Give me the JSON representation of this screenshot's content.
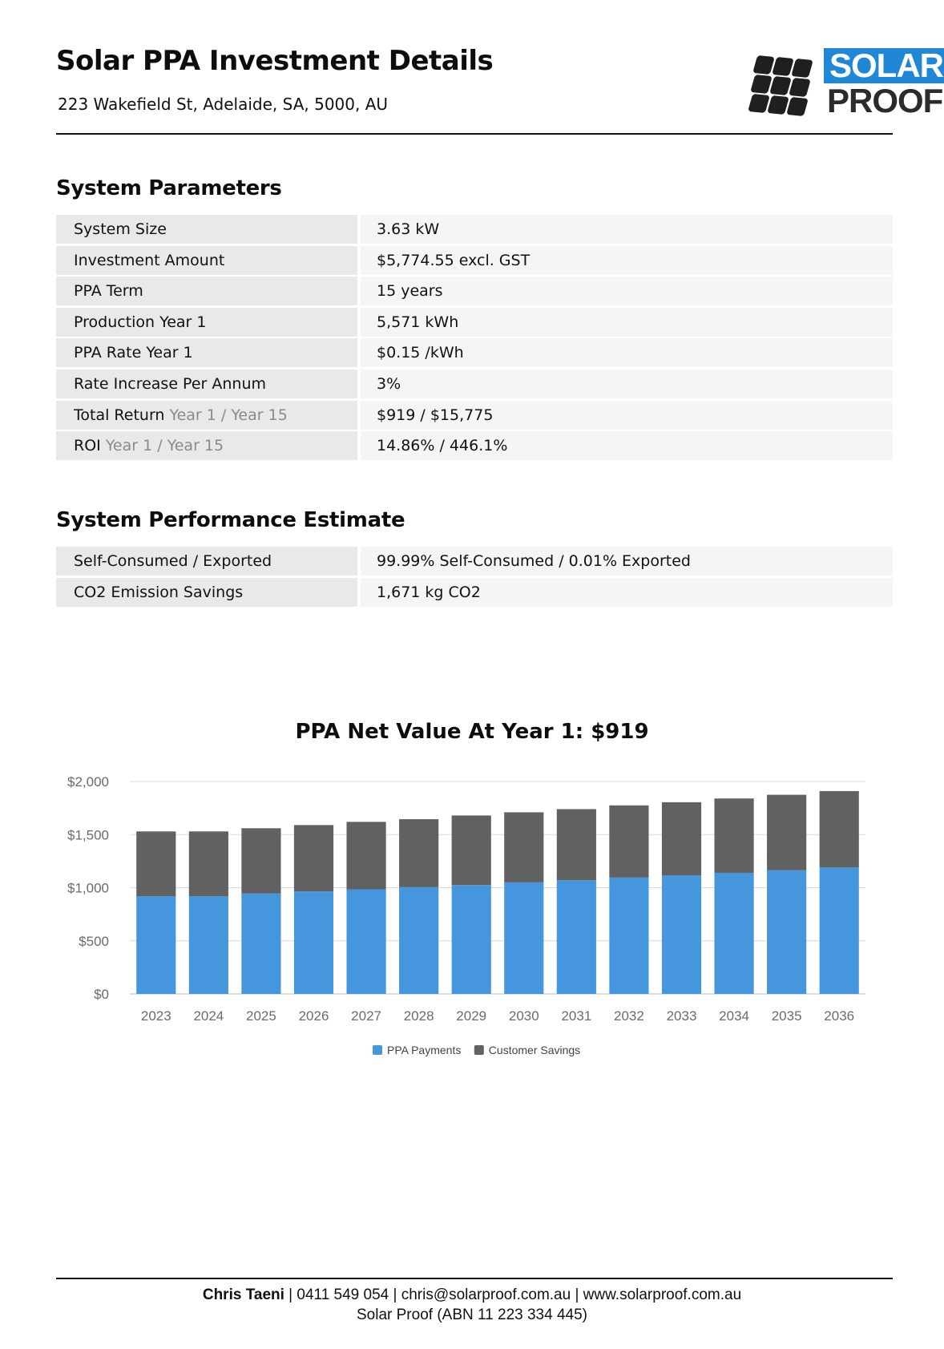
{
  "header": {
    "title": "Solar PPA Investment Details",
    "address": "223 Wakefield St, Adelaide, SA, 5000, AU",
    "logo_top": "SOLAR",
    "logo_bottom": "PROOF",
    "logo_colors": {
      "accent": "#1f87d6",
      "dark": "#2b2b2b"
    }
  },
  "system_parameters": {
    "title": "System Parameters",
    "rows": [
      {
        "label": "System Size",
        "value": "3.63 kW"
      },
      {
        "label": "Investment Amount",
        "value": "$5,774.55 excl. GST"
      },
      {
        "label": "PPA Term",
        "value": "15 years"
      },
      {
        "label": "Production Year 1",
        "value": "5,571 kWh"
      },
      {
        "label": "PPA Rate Year 1",
        "value": "$0.15 /kWh"
      },
      {
        "label": "Rate Increase Per Annum",
        "value": "3%"
      },
      {
        "label": "Total Return",
        "label_suffix": "Year 1 / Year 15",
        "value": "$919 / $15,775"
      },
      {
        "label": "ROI",
        "label_suffix": "Year 1 / Year 15",
        "value": "14.86% / 446.1%"
      }
    ]
  },
  "performance": {
    "title": "System Performance Estimate",
    "rows": [
      {
        "label": "Self-Consumed / Exported",
        "value": "99.99% Self-Consumed / 0.01% Exported"
      },
      {
        "label": "CO2 Emission Savings",
        "value": "1,671 kg CO2"
      }
    ]
  },
  "chart_data": {
    "type": "bar",
    "stacked": true,
    "title": "PPA Net Value At Year 1: $919",
    "categories": [
      "2023",
      "2024",
      "2025",
      "2026",
      "2027",
      "2028",
      "2029",
      "2030",
      "2031",
      "2032",
      "2033",
      "2034",
      "2035",
      "2036"
    ],
    "series": [
      {
        "name": "PPA Payments",
        "color": "#4596dd",
        "values": [
          920,
          920,
          945,
          965,
          985,
          1005,
          1025,
          1050,
          1070,
          1095,
          1115,
          1140,
          1165,
          1190
        ]
      },
      {
        "name": "Customer Savings",
        "color": "#616161",
        "values": [
          610,
          610,
          615,
          625,
          635,
          640,
          655,
          660,
          670,
          680,
          690,
          700,
          710,
          720
        ]
      }
    ],
    "ylim": [
      0,
      2000
    ],
    "yticks": [
      0,
      500,
      1000,
      1500,
      2000
    ],
    "ytick_labels": [
      "$0",
      "$500",
      "$1,000",
      "$1,500",
      "$2,000"
    ],
    "grid": true,
    "legend_position": "bottom"
  },
  "footer": {
    "name": "Chris Taeni",
    "contact": " | 0411 549 054 | chris@solarproof.com.au | www.solarproof.com.au",
    "company": "Solar Proof (ABN 11 223 334 445)"
  }
}
